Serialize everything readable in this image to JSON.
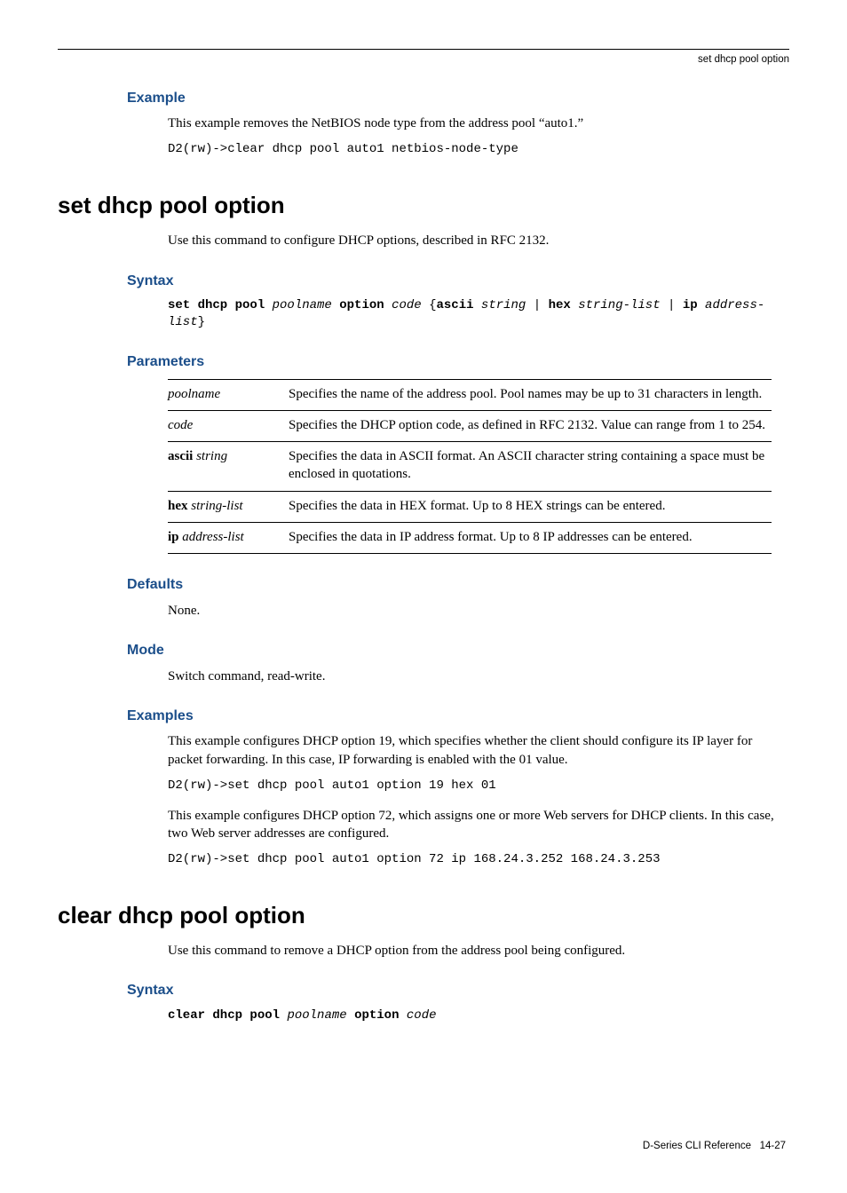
{
  "header_label": "set dhcp pool option",
  "s1": {
    "h_example": "Example",
    "p_example": "This example removes the NetBIOS node type from the address pool “auto1.”",
    "code_example": "D2(rw)->clear dhcp pool auto1 netbios-node-type"
  },
  "s2": {
    "title": "set dhcp pool option",
    "intro": "Use this command to configure DHCP options, described in RFC 2132.",
    "h_syntax": "Syntax",
    "syntax_b1": "set dhcp pool",
    "syntax_i1": "poolname",
    "syntax_b2": "option",
    "syntax_i2": "code",
    "syntax_b3": "ascii",
    "syntax_i3": "string",
    "syntax_b4": "hex",
    "syntax_i4": "string-list",
    "syntax_b5": "ip",
    "syntax_i5": "address-list",
    "h_parameters": "Parameters",
    "params": [
      {
        "name_i": "poolname",
        "desc": "Specifies the name of the address pool. Pool names may be up to 31 characters in length."
      },
      {
        "name_i": "code",
        "desc": "Specifies the DHCP option code, as defined in RFC 2132. Value can range from 1 to 254."
      },
      {
        "name_b": "ascii",
        "name_i": "string",
        "desc": "Specifies the data in ASCII format. An ASCII character string containing a space must be enclosed in quotations."
      },
      {
        "name_b": "hex",
        "name_i": "string-list",
        "desc": "Specifies the data in HEX format. Up to 8 HEX strings can be entered."
      },
      {
        "name_b": "ip",
        "name_i": "address-list",
        "desc": "Specifies the data in IP address format. Up to 8 IP addresses can be entered."
      }
    ],
    "h_defaults": "Defaults",
    "defaults_text": "None.",
    "h_mode": "Mode",
    "mode_text": "Switch command, read-write.",
    "h_examples": "Examples",
    "ex1_text": "This example configures DHCP option 19, which specifies whether the client should configure its IP layer for packet forwarding. In this case, IP forwarding is enabled with the 01 value.",
    "ex1_code": "D2(rw)->set dhcp pool auto1 option 19 hex 01",
    "ex2_text": "This example configures DHCP option 72, which assigns one or more Web servers for DHCP clients. In this case, two Web server addresses are configured.",
    "ex2_code": "D2(rw)->set dhcp pool auto1 option 72 ip 168.24.3.252 168.24.3.253"
  },
  "s3": {
    "title": "clear dhcp pool option",
    "intro": "Use this command to remove a DHCP option from the address pool being configured.",
    "h_syntax": "Syntax",
    "syntax_b1": "clear dhcp pool",
    "syntax_i1": "poolname",
    "syntax_b2": "option",
    "syntax_i2": "code"
  },
  "footer": {
    "book": "D-Series CLI Reference",
    "page": "14-27"
  }
}
